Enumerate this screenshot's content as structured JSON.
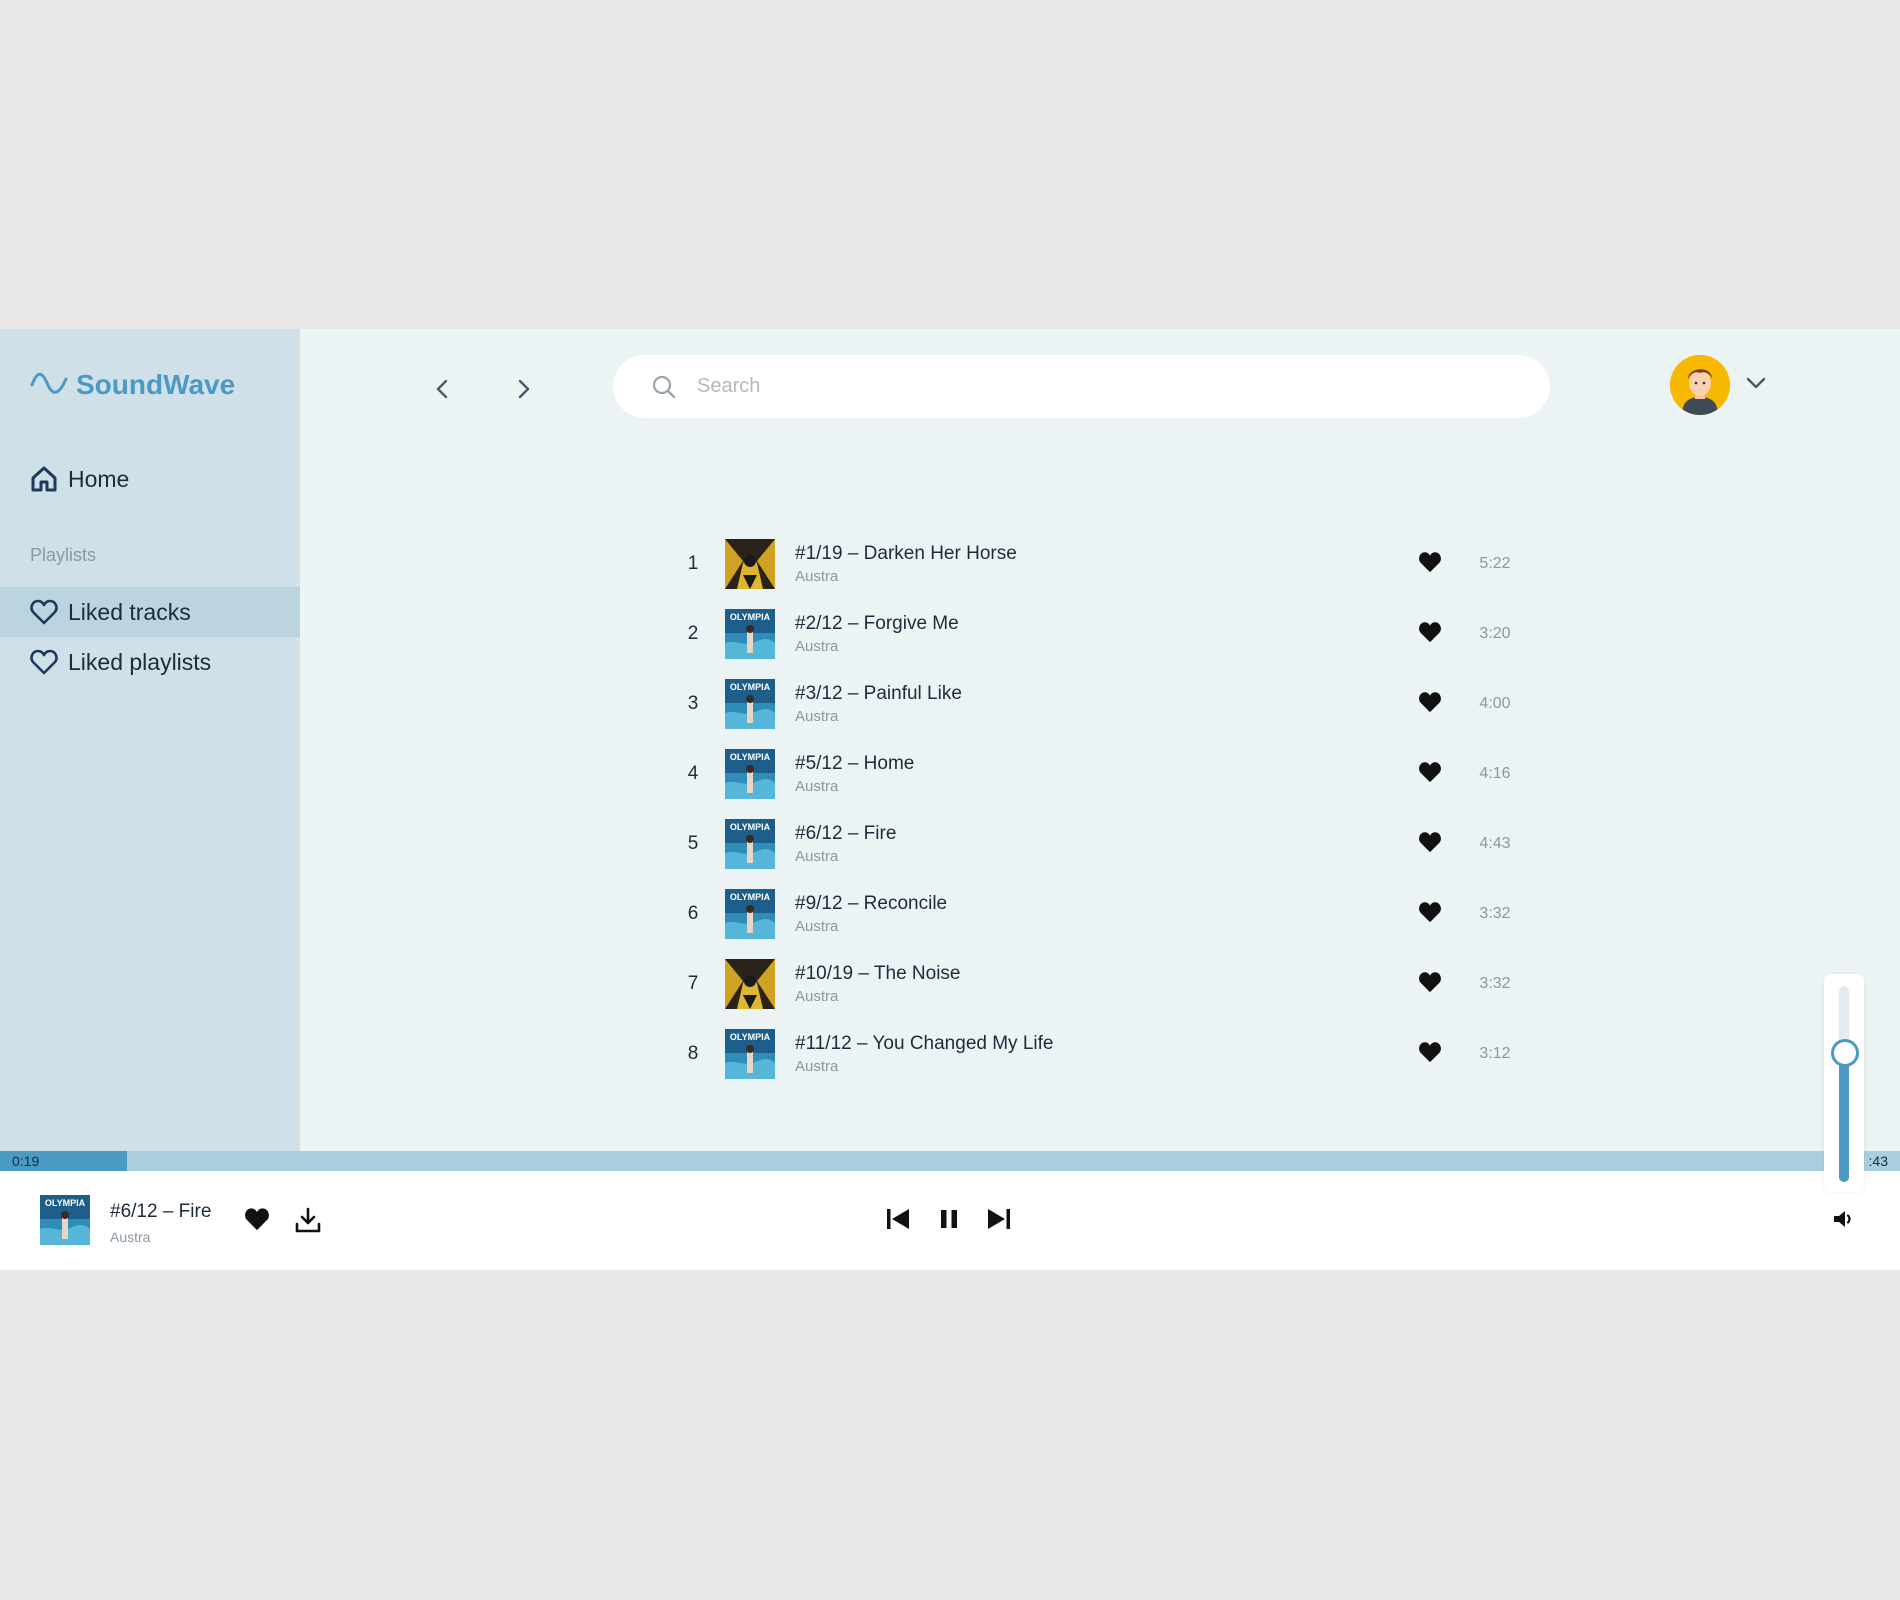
{
  "app": {
    "name": "SoundWave",
    "accent": "#4a9ac4"
  },
  "sidebar": {
    "home_label": "Home",
    "section_label": "Playlists",
    "items": [
      {
        "label": "Liked tracks",
        "icon": "heart-outline-icon",
        "active": true
      },
      {
        "label": "Liked playlists",
        "icon": "heart-outline-icon",
        "active": false
      }
    ]
  },
  "search": {
    "placeholder": "Search",
    "value": ""
  },
  "tracks": [
    {
      "num": "1",
      "title": "#1/19 – Darken Her Horse",
      "artist": "Austra",
      "duration": "5:22",
      "cover": "gold-cover",
      "liked": true
    },
    {
      "num": "2",
      "title": "#2/12 – Forgive Me",
      "artist": "Austra",
      "duration": "3:20",
      "cover": "olympia-cover",
      "liked": true
    },
    {
      "num": "3",
      "title": "#3/12 – Painful Like",
      "artist": "Austra",
      "duration": "4:00",
      "cover": "olympia-cover",
      "liked": true
    },
    {
      "num": "4",
      "title": "#5/12 – Home",
      "artist": "Austra",
      "duration": "4:16",
      "cover": "olympia-cover",
      "liked": true
    },
    {
      "num": "5",
      "title": "#6/12 – Fire",
      "artist": "Austra",
      "duration": "4:43",
      "cover": "olympia-cover",
      "liked": true
    },
    {
      "num": "6",
      "title": "#9/12 – Reconcile",
      "artist": "Austra",
      "duration": "3:32",
      "cover": "olympia-cover",
      "liked": true
    },
    {
      "num": "7",
      "title": "#10/19 – The Noise",
      "artist": "Austra",
      "duration": "3:32",
      "cover": "gold-cover",
      "liked": true
    },
    {
      "num": "8",
      "title": "#11/12 – You Changed My Life",
      "artist": "Austra",
      "duration": "3:12",
      "cover": "olympia-cover",
      "liked": true
    }
  ],
  "player": {
    "title": "#6/12 – Fire",
    "artist": "Austra",
    "current_time": "0:19",
    "total_time": ":43",
    "progress_fraction": 0.067,
    "volume_fraction": 0.66,
    "liked": true
  },
  "cover_text": "OLYMPIA"
}
